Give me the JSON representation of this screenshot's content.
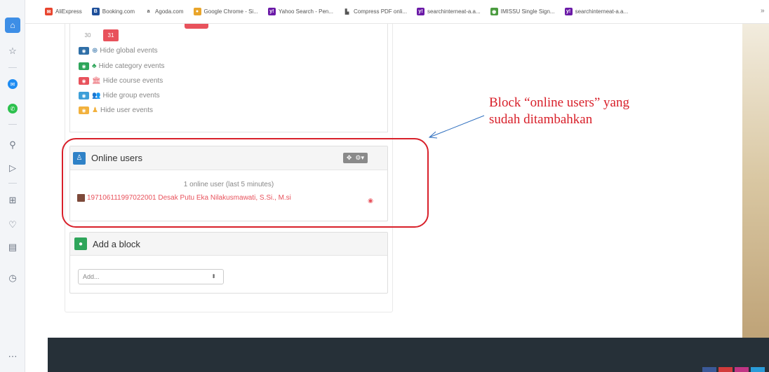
{
  "bookmarks": [
    {
      "label": "AliExpress",
      "color": "#e8442e",
      "glyph": "✉"
    },
    {
      "label": "Booking.com",
      "color": "#1e4f9a",
      "glyph": "B"
    },
    {
      "label": "Agoda.com",
      "color": "#ffffff",
      "glyph": "a"
    },
    {
      "label": "Google Chrome - Si...",
      "color": "#e9a52a",
      "glyph": "●"
    },
    {
      "label": "Yahoo Search - Pen...",
      "color": "#6b1aa7",
      "glyph": "y!"
    },
    {
      "label": "Compress PDF onli...",
      "color": "#ffffff",
      "glyph": "▙"
    },
    {
      "label": "searchinterneat-a.a...",
      "color": "#6b1aa7",
      "glyph": "y!"
    },
    {
      "label": "IMISSU Single Sign...",
      "color": "#4a9b3f",
      "glyph": "◉"
    },
    {
      "label": "searchinterneat-a.a...",
      "color": "#6b1aa7",
      "glyph": "y!"
    }
  ],
  "calendar": {
    "day_30": "30",
    "day_31": "31"
  },
  "event_filters": [
    {
      "label": "Hide global events",
      "eye_color": "#2f6fa7",
      "symbol": "⊕",
      "symbol_color": "#2f6fa7"
    },
    {
      "label": "Hide category events",
      "eye_color": "#2ea55a",
      "symbol": "♣",
      "symbol_color": "#2ea55a"
    },
    {
      "label": "Hide course events",
      "eye_color": "#e8525c",
      "symbol": "🏛",
      "symbol_color": "#e8525c"
    },
    {
      "label": "Hide group events",
      "eye_color": "#3d9fd8",
      "symbol": "👥",
      "symbol_color": "#3d9fd8"
    },
    {
      "label": "Hide user events",
      "eye_color": "#f2b13d",
      "symbol": "♟",
      "symbol_color": "#f2b13d"
    }
  ],
  "online_users": {
    "title": "Online users",
    "summary": "1 online user (last 5 minutes)",
    "users": [
      {
        "name": "197106111997022001 Desak Putu Eka Nilakusmawati, S.Si., M.si"
      }
    ]
  },
  "add_block": {
    "title": "Add a block",
    "select_value": "Add..."
  },
  "annotation": {
    "line1": "Block “online users” yang",
    "line2": "sudah ditambahkan"
  },
  "colors": {
    "highlight": "#d8202a",
    "accent_red": "#e8525c",
    "footer": "#263038"
  }
}
